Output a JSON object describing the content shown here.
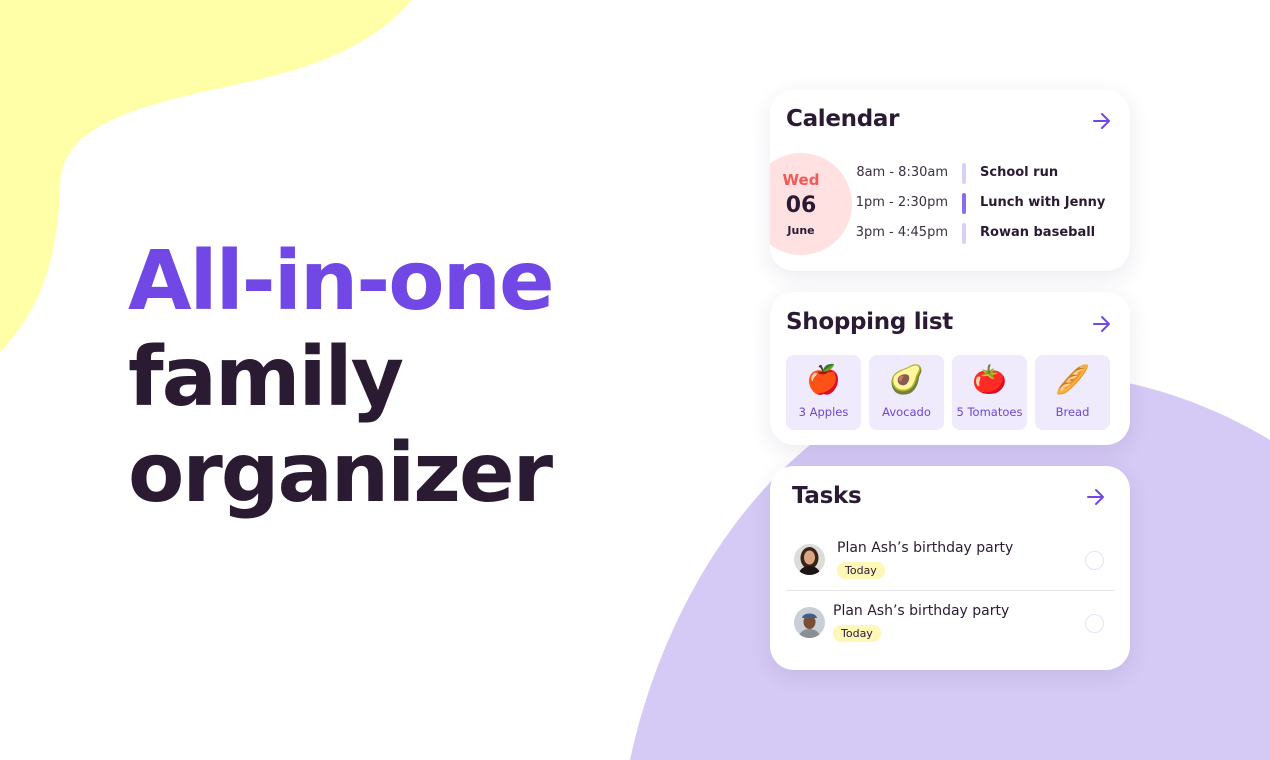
{
  "colors": {
    "accent": "#7147e5",
    "text_dark": "#2a1b33",
    "yellow_blob": "#ffffa8",
    "purple_blob": "#d2c6f5",
    "date_bg": "#ffe1e1",
    "date_day": "#f25a5a",
    "chip_bg": "#efeafc",
    "badge_bg": "#fdf7b8"
  },
  "headline": {
    "line1": "All-in-one",
    "line2": "family",
    "line3": "organizer"
  },
  "calendar": {
    "title": "Calendar",
    "arrow_icon": "arrow-right-icon",
    "date": {
      "weekday": "Wed",
      "day": "06",
      "month": "June"
    },
    "events": [
      {
        "time": "8am - 8:30am",
        "name": "School run",
        "bar_color": "#d9cffa"
      },
      {
        "time": "1pm - 2:30pm",
        "name": "Lunch with Jenny",
        "bar_color": "#8a6cf0"
      },
      {
        "time": "3pm - 4:45pm",
        "name": "Rowan baseball",
        "bar_color": "#d9cffa"
      }
    ]
  },
  "shopping": {
    "title": "Shopping list",
    "arrow_icon": "arrow-right-icon",
    "items": [
      {
        "emoji": "🍎",
        "icon": "apple-icon",
        "label": "3 Apples"
      },
      {
        "emoji": "🥑",
        "icon": "avocado-icon",
        "label": "Avocado"
      },
      {
        "emoji": "🍅",
        "icon": "tomato-icon",
        "label": "5 Tomatoes"
      },
      {
        "emoji": "🥖",
        "icon": "bread-icon",
        "label": "Bread"
      }
    ]
  },
  "tasks": {
    "title": "Tasks",
    "arrow_icon": "arrow-right-icon",
    "items": [
      {
        "title": "Plan Ash’s birthday party",
        "badge": "Today",
        "done": false
      },
      {
        "title": "Plan Ash’s birthday party",
        "badge": "Today",
        "done": false
      }
    ]
  }
}
